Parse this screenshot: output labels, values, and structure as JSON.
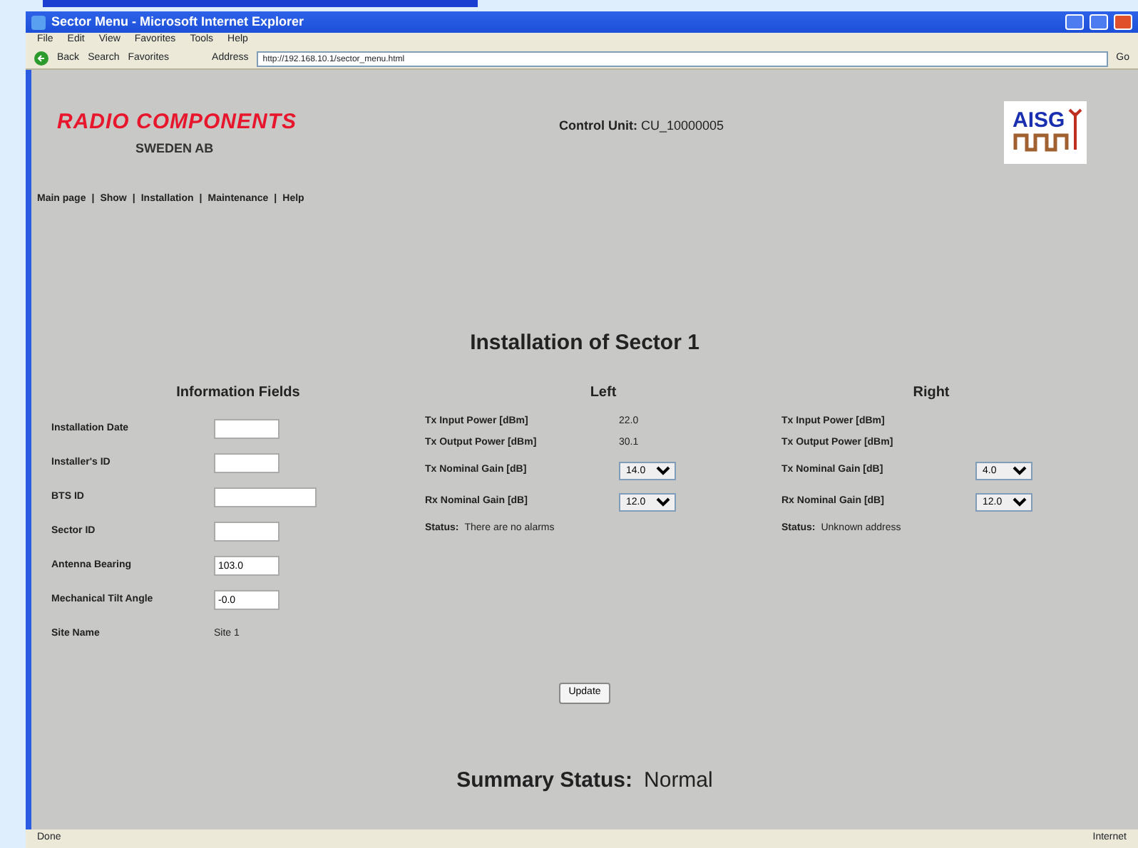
{
  "window": {
    "title": "Sector Menu - Microsoft Internet Explorer"
  },
  "menu": [
    "File",
    "Edit",
    "View",
    "Favorites",
    "Tools",
    "Help"
  ],
  "toolbar": {
    "back": "Back",
    "search": "Search",
    "favorites": "Favorites",
    "address_label": "Address",
    "address": "http://192.168.10.1/sector_menu.html",
    "go": "Go"
  },
  "header": {
    "brand": "RADIO COMPONENTS",
    "brand_sub": "SWEDEN AB",
    "control_unit_label": "Control Unit:",
    "control_unit": "CU_10000005",
    "logo_text": "AISG"
  },
  "nav": [
    {
      "label": "Main page"
    },
    {
      "separator": "|",
      "label": "Show"
    },
    {
      "separator": "|",
      "label": "Installation"
    },
    {
      "separator": "|",
      "label": "Maintenance"
    },
    {
      "separator": "|",
      "label": "Help"
    }
  ],
  "title": "Installation of Sector 1",
  "info": {
    "heading": "Information Fields",
    "fields": [
      {
        "label": "Installation Date",
        "kind": "input"
      },
      {
        "label": "Installer's ID",
        "kind": "input"
      },
      {
        "label": "BTS ID",
        "kind": "wideinput"
      },
      {
        "label": "Sector ID",
        "kind": "input"
      },
      {
        "label": "Antenna Bearing",
        "kind": "input",
        "value": "103.0"
      },
      {
        "label": "Mechanical Tilt Angle",
        "kind": "input",
        "value": "-0.0"
      },
      {
        "label": "Site Name",
        "kind": "text",
        "value": "Site 1"
      }
    ]
  },
  "sectors": [
    {
      "heading": "Left",
      "rows": [
        {
          "label": "Tx Input Power [dBm]",
          "kind": "text",
          "value": "22.0"
        },
        {
          "label": "Tx Output Power [dBm]",
          "kind": "text",
          "value": "30.1"
        },
        {
          "label": "Tx Nominal Gain [dB]",
          "kind": "select",
          "value": "14.0"
        },
        {
          "label": "Rx Nominal Gain [dB]",
          "kind": "select",
          "value": "12.0"
        }
      ],
      "status_label": "Status:",
      "status": "There are no alarms"
    },
    {
      "heading": "Right",
      "rows": [
        {
          "label": "Tx Input Power [dBm]",
          "kind": "text"
        },
        {
          "label": "Tx Output Power [dBm]",
          "kind": "text"
        },
        {
          "label": "Tx Nominal Gain [dB]",
          "kind": "select",
          "value": "4.0"
        },
        {
          "label": "Rx Nominal Gain [dB]",
          "kind": "select",
          "value": "12.0"
        }
      ],
      "status_label": "Status:",
      "status": "Unknown address"
    }
  ],
  "update_button": "Update",
  "summary": {
    "label": "Summary Status:",
    "value": "Normal"
  },
  "status_bar": {
    "left": "Done",
    "right": "Internet"
  }
}
